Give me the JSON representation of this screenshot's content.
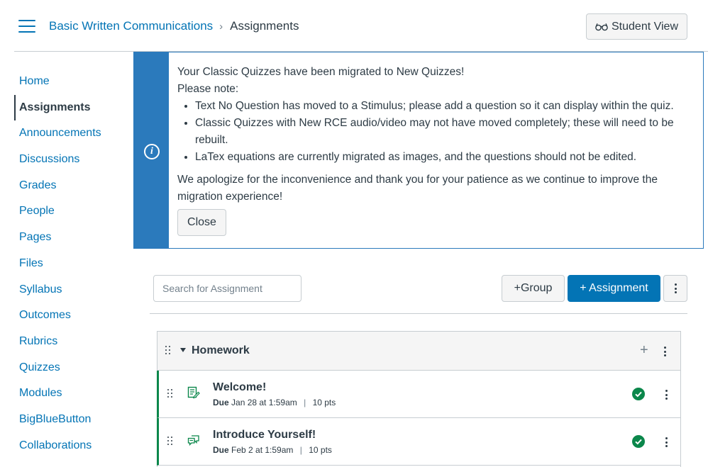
{
  "header": {
    "course_link": "Basic Written Communications",
    "breadcrumb_separator": "›",
    "current_page": "Assignments",
    "student_view_label": "Student View"
  },
  "sidebar": {
    "items": [
      {
        "label": "Home",
        "active": false
      },
      {
        "label": "Assignments",
        "active": true
      },
      {
        "label": "Announcements",
        "active": false
      },
      {
        "label": "Discussions",
        "active": false
      },
      {
        "label": "Grades",
        "active": false
      },
      {
        "label": "People",
        "active": false
      },
      {
        "label": "Pages",
        "active": false
      },
      {
        "label": "Files",
        "active": false
      },
      {
        "label": "Syllabus",
        "active": false
      },
      {
        "label": "Outcomes",
        "active": false
      },
      {
        "label": "Rubrics",
        "active": false
      },
      {
        "label": "Quizzes",
        "active": false
      },
      {
        "label": "Modules",
        "active": false
      },
      {
        "label": "BigBlueButton",
        "active": false
      },
      {
        "label": "Collaborations",
        "active": false
      }
    ]
  },
  "alert": {
    "line1": "Your Classic Quizzes have been migrated to New Quizzes!",
    "line2": "Please note:",
    "bullets": [
      "Text No Question has moved to a Stimulus; please add a question so it can display within the quiz.",
      "Classic Quizzes with New RCE audio/video may not have moved completely; these will need to be rebuilt.",
      "LaTex equations are currently migrated as images, and the questions should not be edited."
    ],
    "closing": "We apologize for the inconvenience and thank you for your patience as we continue to improve the migration experience!",
    "close_label": "Close"
  },
  "toolbar": {
    "search_placeholder": "Search for Assignment",
    "group_button": "+Group",
    "assignment_button": "+ Assignment"
  },
  "group": {
    "title": "Homework",
    "add_symbol": "+",
    "assignments": [
      {
        "title": "Welcome!",
        "due_label": "Due",
        "due_date": "Jan 28 at 1:59am",
        "points": "10 pts",
        "icon": "assignment-icon",
        "published": true
      },
      {
        "title": "Introduce Yourself!",
        "due_label": "Due",
        "due_date": "Feb 2 at 1:59am",
        "points": "10 pts",
        "icon": "discussion-icon",
        "published": true
      }
    ]
  },
  "colors": {
    "link": "#0374b5",
    "text": "#2d3b45",
    "alert_blue": "#2b7abc",
    "success_green": "#0b874b",
    "border": "#c7cdd1"
  }
}
